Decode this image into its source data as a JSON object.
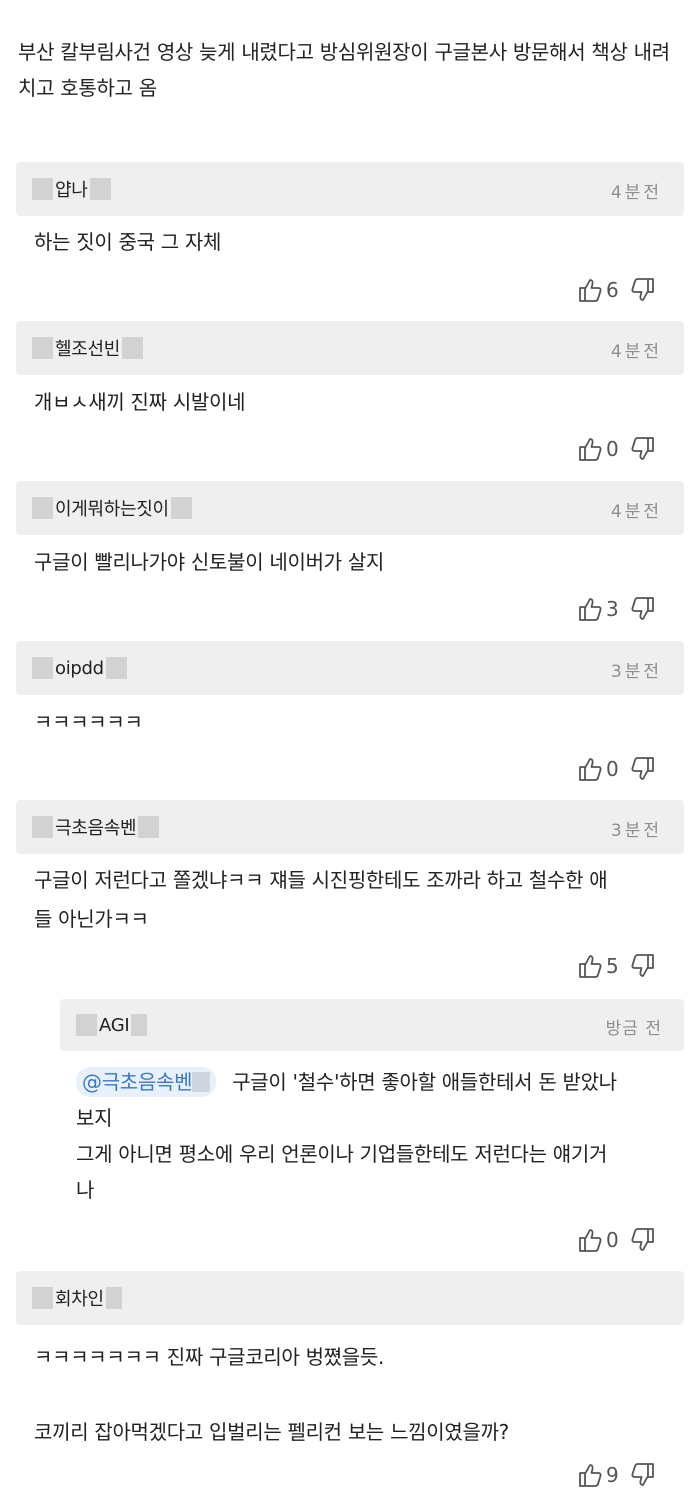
{
  "post": {
    "title": "부산 칼부림사건 영상 늦게 내렸다고 방심위원장이 구글본사 방문해서 책상 내려치고 호통하고 옴"
  },
  "comments": [
    {
      "author": "얍나",
      "time": "4분전",
      "body": "하는 짓이 중국 그 자체",
      "likes": "6"
    },
    {
      "author": "헬조선빈",
      "time": "4분전",
      "body": "개ㅂㅅ새끼 진짜 시발이네",
      "likes": "0"
    },
    {
      "author": "이게뭐하는짓이",
      "time": "4분전",
      "body": "구글이 빨리나가야 신토불이 네이버가 살지",
      "likes": "3"
    },
    {
      "author": "oipdd",
      "time": "3분전",
      "body": "ㅋㅋㅋㅋㅋㅋ",
      "likes": "0"
    },
    {
      "author": "극초음속벤",
      "time": "3분전",
      "body_line1": "구글이 저런다고 쫄겠냐ㅋㅋ 쟤들 시진핑한테도 조까라 하고 철수한 애",
      "body_line2": "들 아닌가ㅋㅋ",
      "likes": "5"
    }
  ],
  "reply": {
    "author": "AGI",
    "time": "방금 전",
    "mention": "@극초음속벤",
    "line1": "구글이 '철수'하면 좋아할 애들한테서 돈 받았나",
    "line2": "보지",
    "line3": "그게 아니면 평소에 우리 언론이나 기업들한테도 저런다는 얘기거",
    "line4": "나",
    "likes": "0"
  },
  "last_comment": {
    "author": "회차인",
    "line1": "ㅋㅋㅋㅋㅋㅋㅋ 진짜 구글코리아 벙쪘을듯.",
    "line2": "코끼리 잡아먹겠다고 입벌리는 펠리컨 보는 느낌이였을까?",
    "likes": "9"
  },
  "icons": {
    "like": "thumbs-up-icon",
    "dislike": "thumbs-down-icon"
  },
  "colors": {
    "header_bg": "#efefef",
    "mention_bg": "#e8f1fb",
    "mention_text": "#3a78c2",
    "muted": "#8e8e8e"
  }
}
